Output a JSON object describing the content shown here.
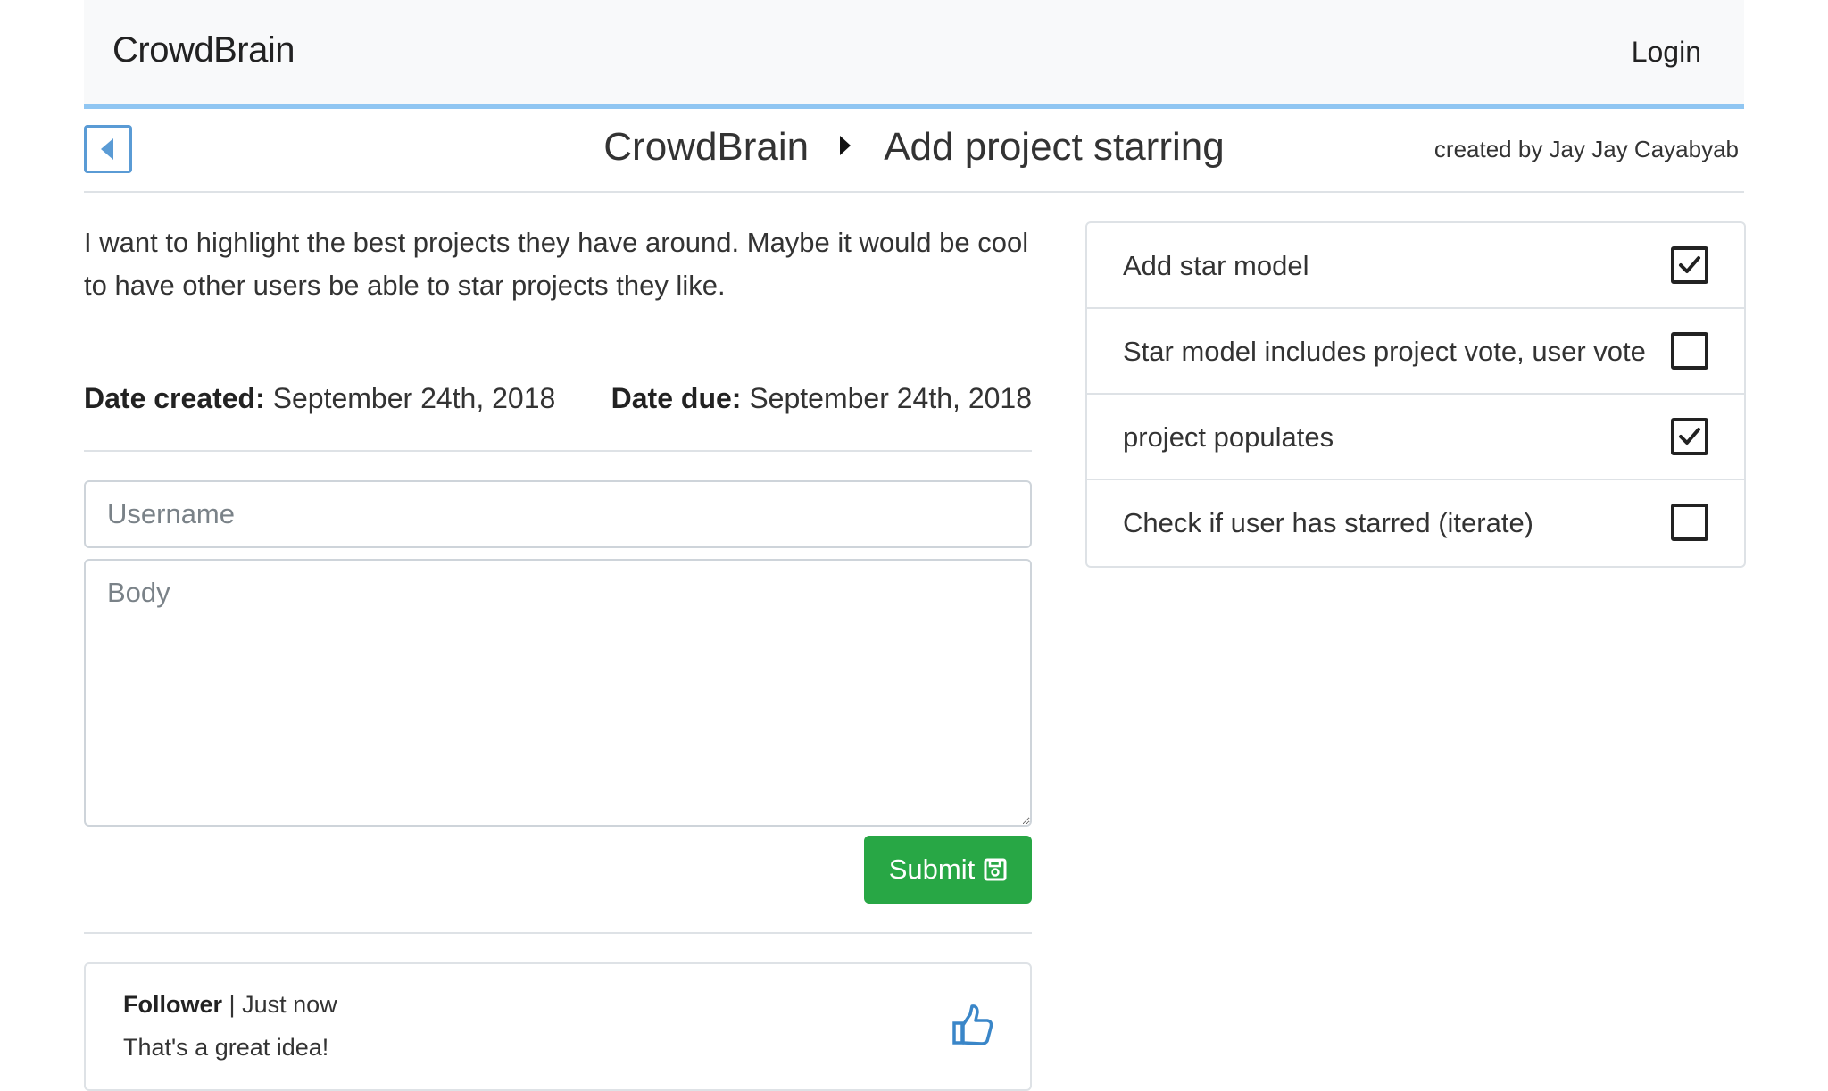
{
  "navbar": {
    "brand": "CrowdBrain",
    "login_label": "Login"
  },
  "titlebar": {
    "breadcrumb_root": "CrowdBrain",
    "breadcrumb_current": "Add project starring",
    "creator": "created by Jay Jay Cayabyab"
  },
  "project": {
    "description": "I want to highlight the best projects they have around. Maybe it would be cool to have other users be able to star projects they like.",
    "date_created_label": "Date created:",
    "date_created": "September 24th, 2018",
    "date_due_label": "Date due:",
    "date_due": "September 24th, 2018"
  },
  "form": {
    "username_placeholder": "Username",
    "username_value": "",
    "body_placeholder": "Body",
    "body_value": "",
    "submit_label": "Submit"
  },
  "comments": [
    {
      "author": "Follower",
      "separator": "|",
      "time": "Just now",
      "text": "That's a great idea!"
    }
  ],
  "tasks": [
    {
      "label": "Add star model",
      "checked": true
    },
    {
      "label": "Star model includes project vote, user vote",
      "checked": false
    },
    {
      "label": "project populates",
      "checked": true
    },
    {
      "label": "Check if user has starred (iterate)",
      "checked": false
    }
  ],
  "icons": {
    "back": "caret-left-icon",
    "breadcrumb_separator": "caret-right-icon",
    "submit": "floppy-disk-icon",
    "like": "thumbs-up-icon",
    "check": "check-icon"
  },
  "colors": {
    "accent_border": "#90c6f2",
    "back_button": "#5a9bd5",
    "submit": "#28a745",
    "like_icon": "#3a86c8"
  }
}
